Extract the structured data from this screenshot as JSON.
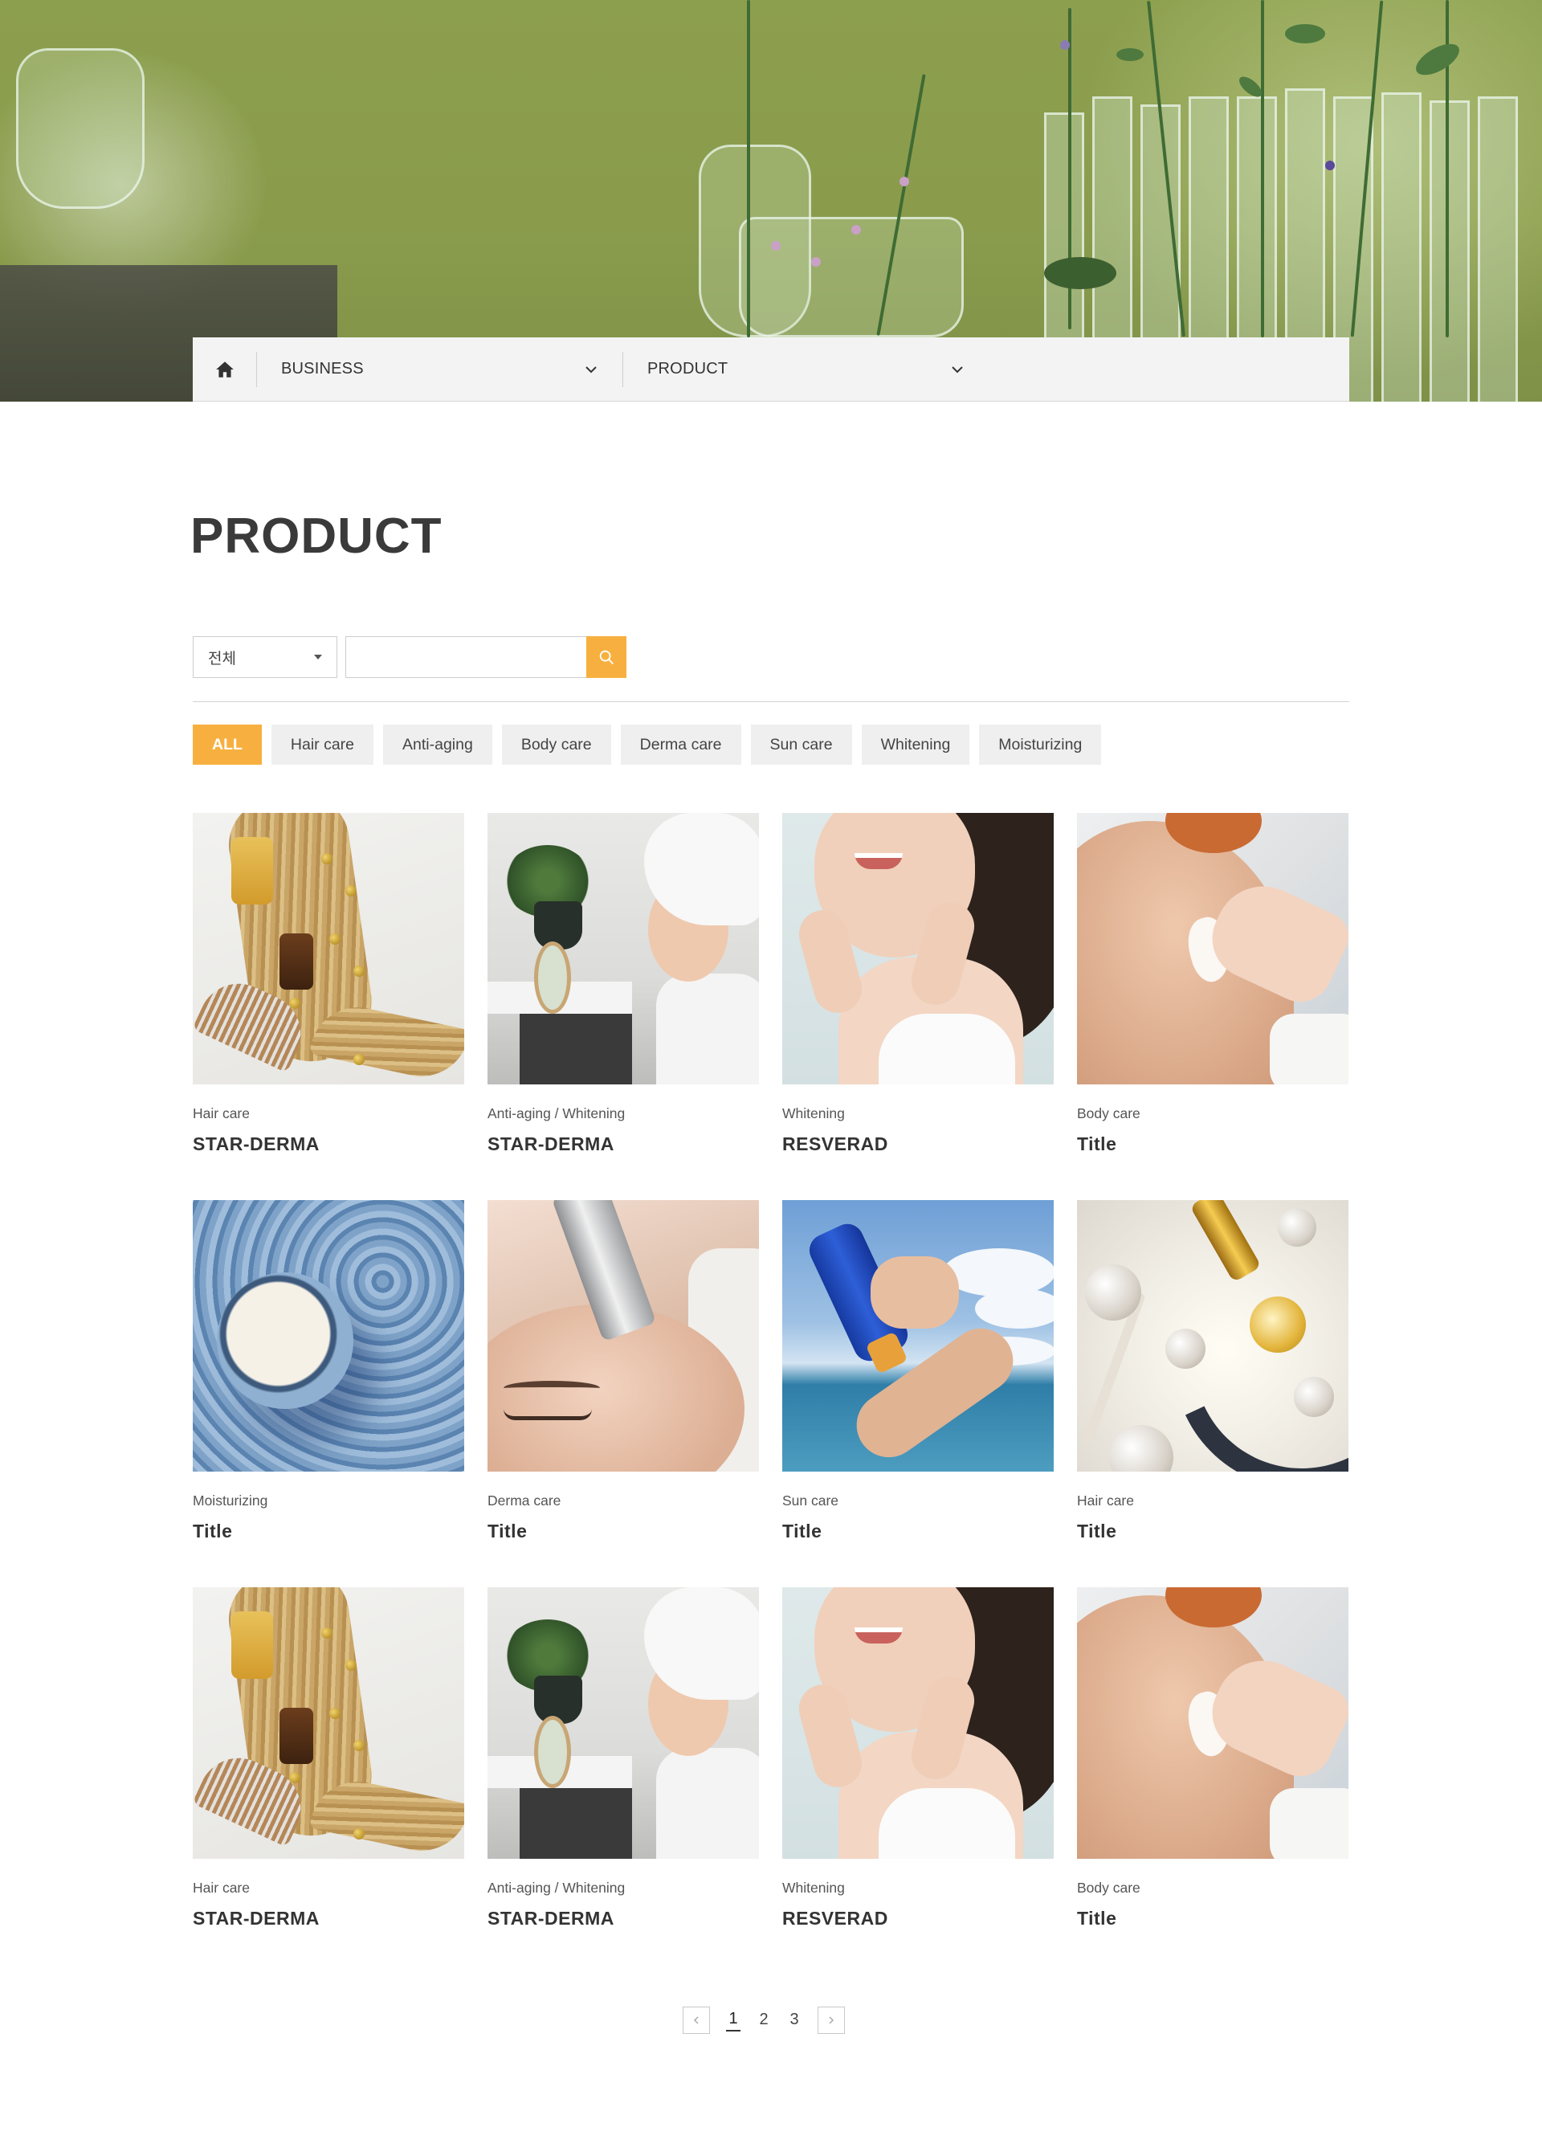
{
  "breadcrumb": {
    "home_icon": "home-icon",
    "items": [
      {
        "label": "BUSINESS",
        "icon": "chevron-down-icon"
      },
      {
        "label": "PRODUCT",
        "icon": "chevron-down-icon"
      }
    ]
  },
  "page": {
    "title": "PRODUCT"
  },
  "search": {
    "select_value": "전체",
    "input_value": "",
    "button_icon": "search-icon"
  },
  "colors": {
    "accent": "#f7b03f",
    "chip_bg": "#efefef",
    "title": "#3a3a3a"
  },
  "filters": [
    {
      "label": "ALL",
      "active": true
    },
    {
      "label": "Hair care",
      "active": false
    },
    {
      "label": "Anti-aging",
      "active": false
    },
    {
      "label": "Body care",
      "active": false
    },
    {
      "label": "Derma care",
      "active": false
    },
    {
      "label": "Sun care",
      "active": false
    },
    {
      "label": "Whitening",
      "active": false
    },
    {
      "label": "Moisturizing",
      "active": false
    }
  ],
  "products": [
    {
      "category": "Hair care",
      "title": "STAR-DERMA",
      "image": "hair-serum-photo"
    },
    {
      "category": "Anti-aging / Whitening",
      "title": "STAR-DERMA",
      "image": "towel-woman-photo"
    },
    {
      "category": "Whitening",
      "title": "RESVERAD",
      "image": "smiling-woman-photo"
    },
    {
      "category": "Body care",
      "title": "Title",
      "image": "shoulder-cream-photo"
    },
    {
      "category": "Moisturizing",
      "title": "Title",
      "image": "cream-jar-photo"
    },
    {
      "category": "Derma care",
      "title": "Title",
      "image": "derma-device-photo"
    },
    {
      "category": "Sun care",
      "title": "Title",
      "image": "sunscreen-photo"
    },
    {
      "category": "Hair care",
      "title": "Title",
      "image": "molecule-serum-photo"
    },
    {
      "category": "Hair care",
      "title": "STAR-DERMA",
      "image": "hair-serum-photo"
    },
    {
      "category": "Anti-aging / Whitening",
      "title": "STAR-DERMA",
      "image": "towel-woman-photo"
    },
    {
      "category": "Whitening",
      "title": "RESVERAD",
      "image": "smiling-woman-photo"
    },
    {
      "category": "Body care",
      "title": "Title",
      "image": "shoulder-cream-photo"
    }
  ],
  "pagination": {
    "prev_icon": "chevron-left-icon",
    "next_icon": "chevron-right-icon",
    "pages": [
      "1",
      "2",
      "3"
    ],
    "current": "1"
  }
}
